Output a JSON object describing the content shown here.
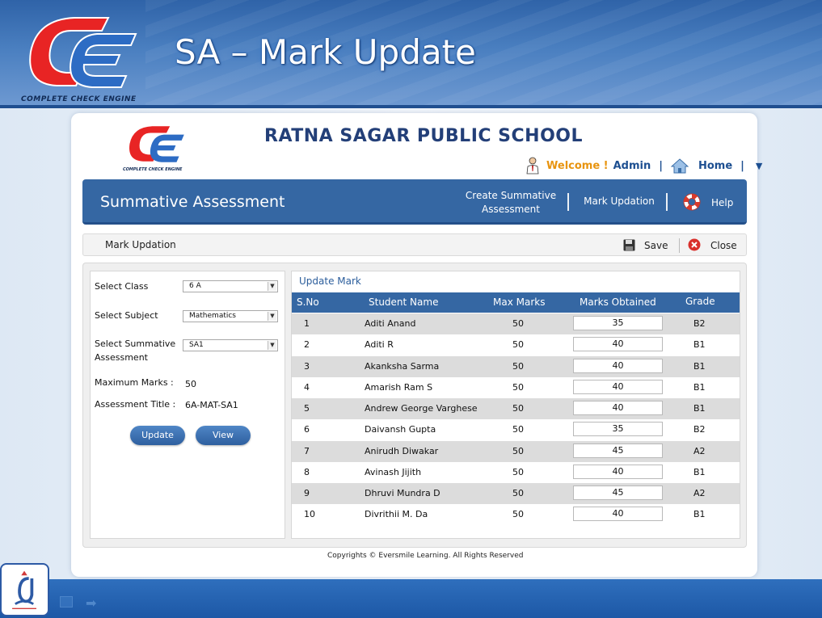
{
  "slide": {
    "title": "SA – Mark Update",
    "logo_caption": "COMPLETE CHECK ENGINE"
  },
  "header": {
    "school_name": "RATNA SAGAR PUBLIC SCHOOL",
    "logo_caption": "COMPLETE CHECK ENGINE",
    "welcome": "Welcome !",
    "user": "Admin",
    "separator": "|",
    "home": "Home",
    "menu_caret": "▼"
  },
  "nav": {
    "title": "Summative Assessment",
    "create_line1": "Create Summative",
    "create_line2": "Assessment",
    "mark_updation": "Mark Updation",
    "help": "Help"
  },
  "toolbar": {
    "title": "Mark Updation",
    "save": "Save",
    "close": "Close"
  },
  "form": {
    "class_label": "Select Class",
    "class_value": "6 A",
    "subject_label": "Select Subject",
    "subject_value": "Mathematics",
    "sa_label_1": "Select Summative",
    "sa_label_2": "Assessment",
    "sa_value": "SA1",
    "max_marks_label": "Maximum Marks :",
    "max_marks_value": "50",
    "title_label": "Assessment Title :",
    "title_value": "6A-MAT-SA1",
    "update_btn": "Update",
    "view_btn": "View"
  },
  "table": {
    "panel_title": "Update Mark",
    "headers": {
      "sno": "S.No",
      "name": "Student Name",
      "max": "Max Marks",
      "obtained": "Marks Obtained",
      "grade": "Grade"
    },
    "rows": [
      {
        "sno": "1",
        "name": "Aditi Anand",
        "max": "50",
        "obtained": "35",
        "grade": "B2"
      },
      {
        "sno": "2",
        "name": "Aditi R",
        "max": "50",
        "obtained": "40",
        "grade": "B1"
      },
      {
        "sno": "3",
        "name": "Akanksha Sarma",
        "max": "50",
        "obtained": "40",
        "grade": "B1"
      },
      {
        "sno": "4",
        "name": "Amarish Ram S",
        "max": "50",
        "obtained": "40",
        "grade": "B1"
      },
      {
        "sno": "5",
        "name": "Andrew George Varghese",
        "max": "50",
        "obtained": "40",
        "grade": "B1"
      },
      {
        "sno": "6",
        "name": "Daivansh Gupta",
        "max": "50",
        "obtained": "35",
        "grade": "B2"
      },
      {
        "sno": "7",
        "name": "Anirudh Diwakar",
        "max": "50",
        "obtained": "45",
        "grade": "A2"
      },
      {
        "sno": "8",
        "name": "Avinash Jijith",
        "max": "50",
        "obtained": "40",
        "grade": "B1"
      },
      {
        "sno": "9",
        "name": "Dhruvi Mundra D",
        "max": "50",
        "obtained": "45",
        "grade": "A2"
      },
      {
        "sno": "10",
        "name": "Divrithii M. Da",
        "max": "50",
        "obtained": "40",
        "grade": "B1"
      }
    ]
  },
  "footer": {
    "copyright": "Copyrights © Eversmile Learning. All Rights Reserved"
  },
  "colors": {
    "brand_blue": "#3567a3",
    "welcome_orange": "#e8940f",
    "logo_red": "#e02020",
    "logo_blue": "#2d6cc4"
  }
}
